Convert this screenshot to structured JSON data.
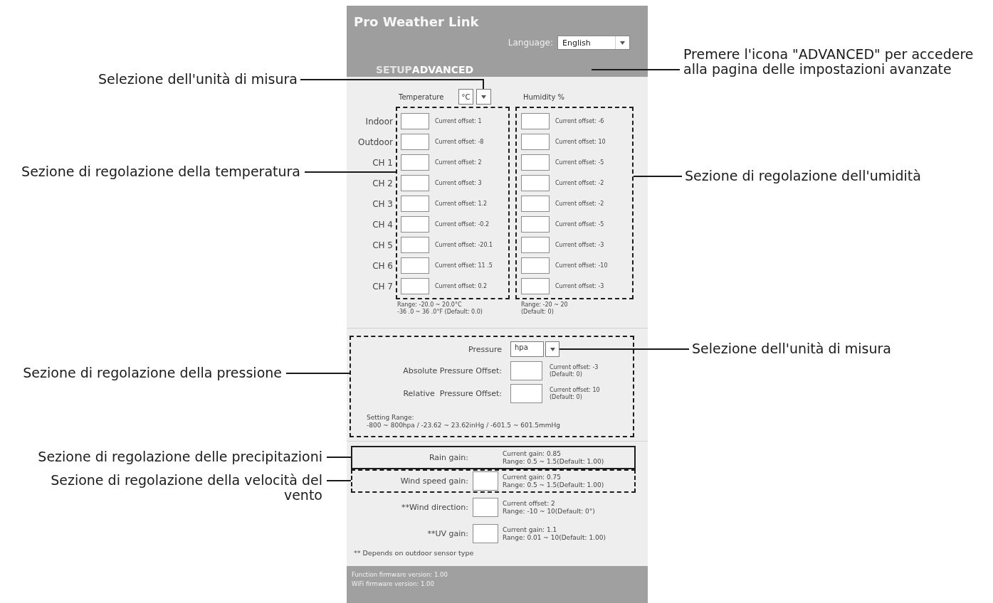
{
  "header": {
    "title": "Pro Weather Link",
    "language_label": "Language:",
    "language": "English"
  },
  "tabs": [
    {
      "label": "SETUP",
      "selected": false
    },
    {
      "label": "ADVANCED",
      "selected": true,
      "callout": "Premere l'icona \"ADVANCED\" per accedere\nalla pagina delle impostazioni avanzate"
    }
  ],
  "temperature": {
    "label": "Temperature",
    "unit": "°C",
    "unit_callout": "Selezione dell'unità di misura",
    "callout": "Sezione di regolazione della temperatura",
    "rows": [
      {
        "channel": "Indoor",
        "offset": "Current offset: 1"
      },
      {
        "channel": "Outdoor",
        "offset": "Current offset: -8"
      },
      {
        "channel": "CH 1",
        "offset": "Current offset: 2"
      },
      {
        "channel": "CH 2",
        "offset": "Current offset: 3"
      },
      {
        "channel": "CH 3",
        "offset": "Current offset: 1.2"
      },
      {
        "channel": "CH 4",
        "offset": "Current offset: -0.2"
      },
      {
        "channel": "CH 5",
        "offset": "Current offset: -20.1"
      },
      {
        "channel": "CH 6",
        "offset": "Current offset: 11 .5"
      },
      {
        "channel": "CH 7",
        "offset": "Current offset: 0.2"
      }
    ],
    "range": "Range: -20.0 ~ 20.0°C\n-36 .0 ~ 36 .0°F (Default: 0.0)"
  },
  "humidity": {
    "label": "Humidity %",
    "callout": "Sezione di regolazione dell'umidità",
    "rows": [
      {
        "offset": "Current offset: -6"
      },
      {
        "offset": "Current offset: 10"
      },
      {
        "offset": "Current offset: -5"
      },
      {
        "offset": "Current offset: -2"
      },
      {
        "offset": "Current offset: -2"
      },
      {
        "offset": "Current offset: -5"
      },
      {
        "offset": "Current offset: -3"
      },
      {
        "offset": "Current offset: -10"
      },
      {
        "offset": "Current offset: -3"
      }
    ],
    "range": "Range: -20 ~ 20\n(Default: 0)"
  },
  "pressure": {
    "label": "Pressure",
    "unit": "hpa",
    "unit_callout": "Selezione dell'unità di misura",
    "callout": "Sezione di regolazione della pressione",
    "rows": [
      {
        "label": "Absolute Pressure Offset:",
        "note": "Current offset: -3\n(Default: 0)"
      },
      {
        "label": "Relative  Pressure Offset:",
        "note": "Current offset: 10\n(Default: 0)"
      }
    ],
    "range": "Setting Range:\n-800 ~ 800hpa / -23.62 ~ 23.62inHg / -601.5 ~ 601.5mmHg"
  },
  "gains": [
    {
      "kind": "plain",
      "label": "Rain gain:",
      "note": "Current gain: 0.85\nRange: 0.5 ~ 1.5(Default: 1.00)",
      "callout": "Sezione di regolazione delle precipitazioni",
      "dashed": false
    },
    {
      "kind": "field",
      "label": "Wind speed gain:",
      "note": "Current gain: 0.75\nRange: 0.5 ~ 1.5(Default: 1.00)",
      "callout": "Sezione di regolazione della velocità del\nvento",
      "dashed": true
    },
    {
      "kind": "field",
      "label": "**Wind direction:",
      "note": "Current offset: 2\nRange: -10 ~ 10(Default: 0°)"
    },
    {
      "kind": "field",
      "label": "**UV gain:",
      "note": "Current gain: 1.1\nRange: 0.01 ~ 10(Default: 1.00)"
    }
  ],
  "footnote": "** Depends on outdoor sensor type",
  "footer": [
    "Function firmware version: 1.00",
    "WiFi firmware version: 1.00"
  ]
}
